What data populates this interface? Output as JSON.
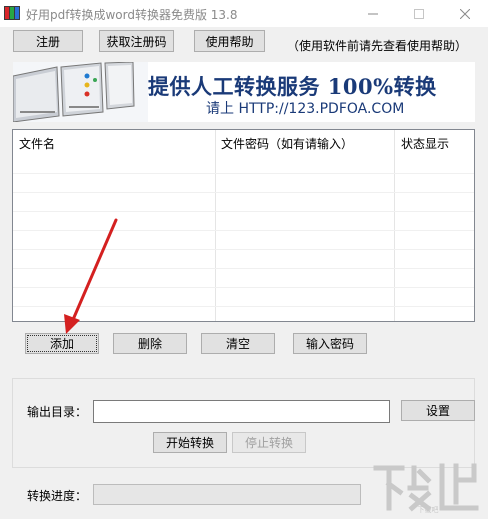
{
  "window": {
    "title": "好用pdf转换成word转换器免费版 13.8",
    "controls": {
      "minimize": "—",
      "maximize": "☐",
      "close": "✕"
    }
  },
  "toolbar": {
    "register_label": "注册",
    "get_code_label": "获取注册码",
    "help_label": "使用帮助",
    "hint_text": "（使用软件前请先查看使用帮助）"
  },
  "banner": {
    "title": "提供人工转换服务 100%转换",
    "url_line": "请上  HTTP://123.PDFOA.COM"
  },
  "file_list": {
    "columns": [
      "文件名",
      "文件密码（如有请输入）",
      "状态显示"
    ],
    "rows": []
  },
  "actions": {
    "add_label": "添加",
    "delete_label": "删除",
    "clear_label": "清空",
    "password_label": "输入密码"
  },
  "output": {
    "dir_label": "输出目录：",
    "dir_value": "",
    "settings_label": "设置",
    "start_label": "开始转换",
    "stop_label": "停止转换"
  },
  "progress": {
    "label": "转换进度：",
    "value": 0
  },
  "watermark": {
    "text": "下载吧"
  },
  "colors": {
    "banner_text": "#1a3a78",
    "arrow": "#d42020"
  }
}
